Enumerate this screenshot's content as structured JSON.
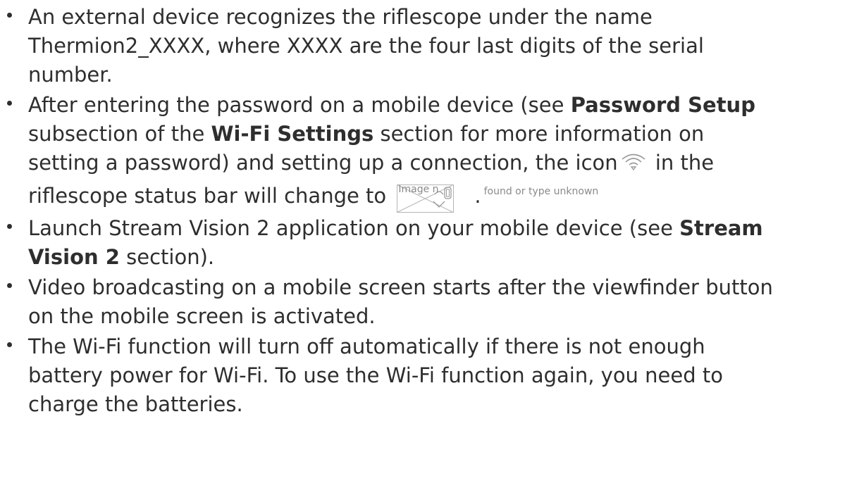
{
  "bullets": [
    {
      "lines": [
        "An external device recognizes the riflescope under the name",
        "Thermion2_XXXX, where XXXX are the four last digits of the serial",
        "number."
      ]
    },
    {
      "line1_a": "After entering the password on a mobile device (see ",
      "line1_bold": "Password Setup",
      "line2_a": "subsection of the ",
      "line2_bold": "Wi-Fi Settings",
      "line2_b": " section for more information on",
      "line3_a": "setting a password) and setting up a connection, the icon",
      "line3_b": " in the",
      "line4_a": "riflescope status bar will change to ",
      "line4_b": ".",
      "icon_wifi": "wifi-icon",
      "broken_image_alt": "Image n",
      "broken_image_alt_rest": "found or type unknown"
    },
    {
      "line1_a": "Launch Stream Vision 2 application on your mobile device (see ",
      "line1_bold": "Stream",
      "line2_bold": "Vision 2",
      "line2_a": " section)."
    },
    {
      "lines": [
        "Video broadcasting on a mobile screen starts after the viewfinder button",
        "on the mobile screen is activated."
      ]
    },
    {
      "lines": [
        "The Wi-Fi function will turn off automatically if there is not enough",
        "battery power for Wi-Fi. To use the Wi-Fi function again, you need to",
        "charge the batteries."
      ]
    }
  ],
  "colors": {
    "text": "#2e2e2e",
    "alt_text": "#8a8a8a"
  }
}
